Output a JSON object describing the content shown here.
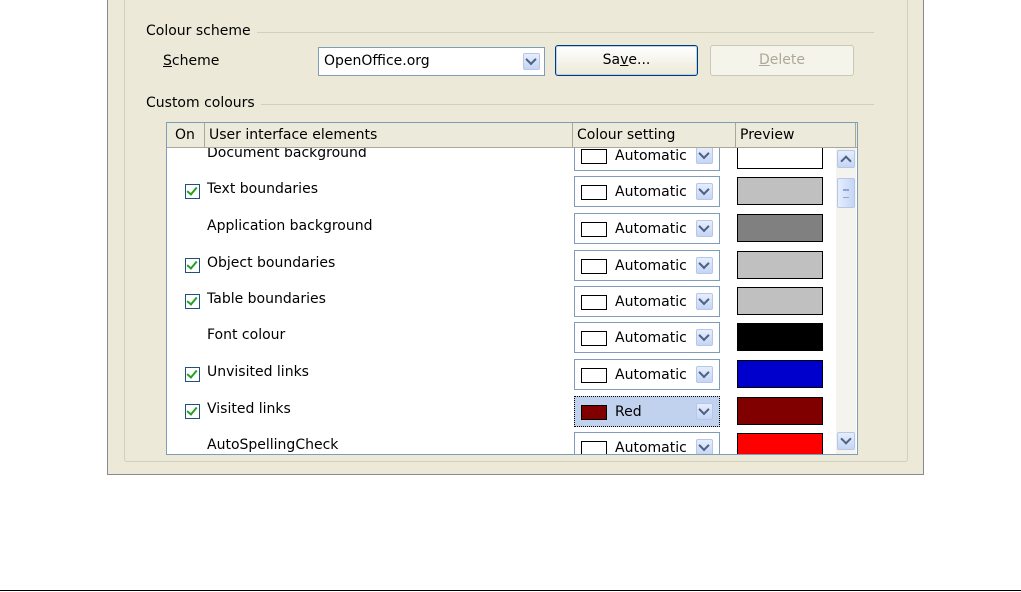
{
  "colour_scheme": {
    "section_title": "Colour scheme",
    "scheme_label_prefix": "S",
    "scheme_label_rest": "cheme",
    "scheme_value": "OpenOffice.org",
    "save_prefix": "Sa",
    "save_accel": "v",
    "save_rest": "e...",
    "delete_accel": "D",
    "delete_rest": "elete"
  },
  "custom_colours": {
    "section_title": "Custom colours",
    "columns": [
      "On",
      "User interface elements",
      "Colour setting",
      "Preview"
    ],
    "rows": [
      {
        "checkbox": false,
        "label": "Document background",
        "setting": "Automatic",
        "swatch": "#ffffff",
        "preview": "#ffffff",
        "selected": false
      },
      {
        "checkbox": true,
        "label": "Text boundaries",
        "setting": "Automatic",
        "swatch": "#ffffff",
        "preview": "#c0c0c0",
        "selected": false
      },
      {
        "checkbox": false,
        "label": "Application background",
        "setting": "Automatic",
        "swatch": "#ffffff",
        "preview": "#808080",
        "selected": false
      },
      {
        "checkbox": true,
        "label": "Object boundaries",
        "setting": "Automatic",
        "swatch": "#ffffff",
        "preview": "#c0c0c0",
        "selected": false
      },
      {
        "checkbox": true,
        "label": "Table boundaries",
        "setting": "Automatic",
        "swatch": "#ffffff",
        "preview": "#c0c0c0",
        "selected": false
      },
      {
        "checkbox": false,
        "label": "Font colour",
        "setting": "Automatic",
        "swatch": "#ffffff",
        "preview": "#000000",
        "selected": false
      },
      {
        "checkbox": true,
        "label": "Unvisited links",
        "setting": "Automatic",
        "swatch": "#ffffff",
        "preview": "#0000cc",
        "selected": false
      },
      {
        "checkbox": true,
        "label": "Visited links",
        "setting": "Red",
        "swatch": "#800000",
        "preview": "#800000",
        "selected": true
      },
      {
        "checkbox": false,
        "label": "AutoSpellingCheck",
        "setting": "Automatic",
        "swatch": "#ffffff",
        "preview": "#ff0000",
        "selected": false
      }
    ]
  }
}
